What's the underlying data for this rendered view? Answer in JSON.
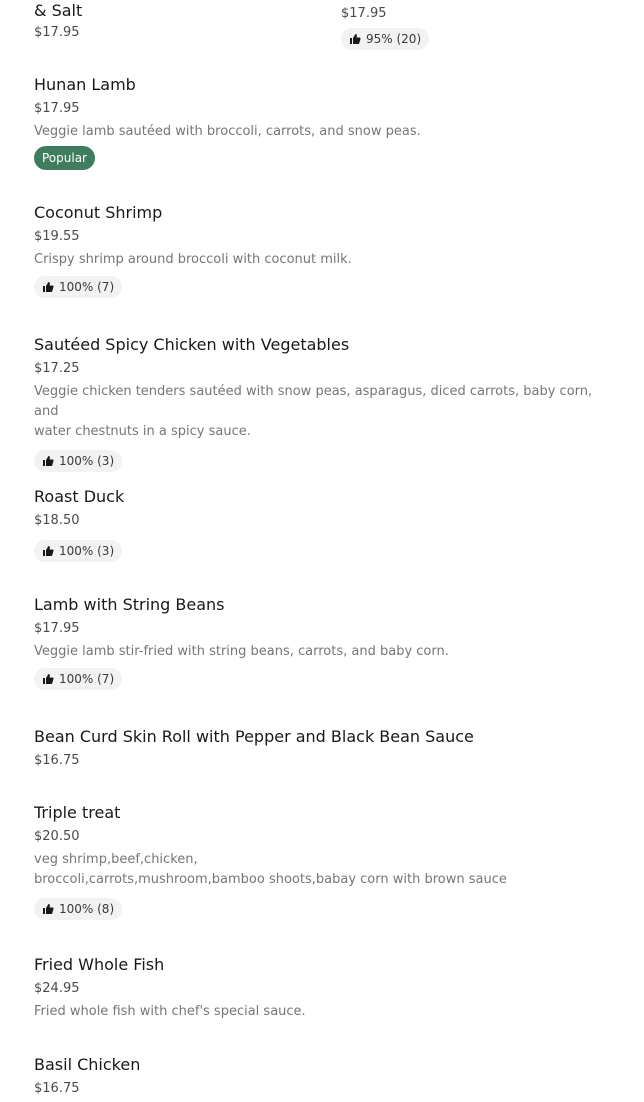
{
  "top_left_item": {
    "name_tail": "& Salt",
    "price": "$17.95"
  },
  "top_right_item": {
    "price": "$17.95",
    "rating": "95% (20)"
  },
  "items": [
    {
      "name": "Hunan Lamb",
      "price": "$17.95",
      "description": "Veggie lamb sautéed with broccoli, carrots, and snow peas.",
      "badge": "Popular"
    },
    {
      "name": "Coconut Shrimp",
      "price": "$19.55",
      "description": "Crispy shrimp around broccoli with coconut milk.",
      "rating": "100% (7)"
    },
    {
      "name": "Sautéed Spicy Chicken with Vegetables",
      "price": "$17.25",
      "description_line1": "Veggie chicken tenders sautéed with snow peas, asparagus, diced carrots, baby corn, and",
      "description_line2": "water chestnuts in a spicy sauce.",
      "rating": "100% (3)"
    },
    {
      "name": "Roast Duck",
      "price": "$18.50",
      "rating": "100% (3)"
    },
    {
      "name": "Lamb with String Beans",
      "price": "$17.95",
      "description": "Veggie lamb stir-fried with string beans, carrots, and baby corn.",
      "rating": "100% (7)"
    },
    {
      "name": "Bean Curd Skin Roll with Pepper and Black Bean Sauce",
      "price": "$16.75"
    },
    {
      "name": "Triple treat",
      "price": "$20.50",
      "description_line1": "veg shrimp,beef,chicken,",
      "description_line2": "broccoli,carrots,mushroom,bamboo shoots,babay corn with brown sauce",
      "rating": "100% (8)"
    },
    {
      "name": "Fried Whole Fish",
      "price": "$24.95",
      "description": "Fried whole fish with chef's special sauce."
    },
    {
      "name": "Basil Chicken",
      "price": "$16.75"
    }
  ]
}
